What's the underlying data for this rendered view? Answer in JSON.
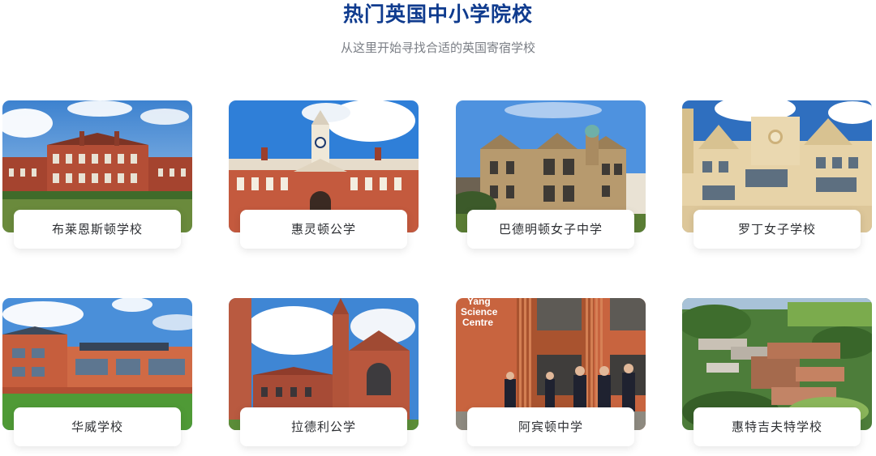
{
  "header": {
    "title": "热门英国中小学院校",
    "subtitle": "从这里开始寻找合适的英国寄宿学校"
  },
  "schools": [
    {
      "name": "布莱恩斯顿学校",
      "photo": "red-brick-mansion-photo"
    },
    {
      "name": "惠灵顿公学",
      "photo": "clock-tower-college-photo"
    },
    {
      "name": "巴德明顿女子中学",
      "photo": "stone-manor-photo"
    },
    {
      "name": "罗丁女子学校",
      "photo": "cream-stone-hall-photo"
    },
    {
      "name": "华威学校",
      "photo": "modern-brick-campus-photo"
    },
    {
      "name": "拉德利公学",
      "photo": "gothic-chapel-photo"
    },
    {
      "name": "阿宾顿中学",
      "photo": "science-centre-students-photo"
    },
    {
      "name": "惠特吉夫特学校",
      "photo": "aerial-campus-photo"
    }
  ],
  "photo_sign": {
    "line1": "Yang",
    "line2": "Science",
    "line3": "Centre"
  }
}
